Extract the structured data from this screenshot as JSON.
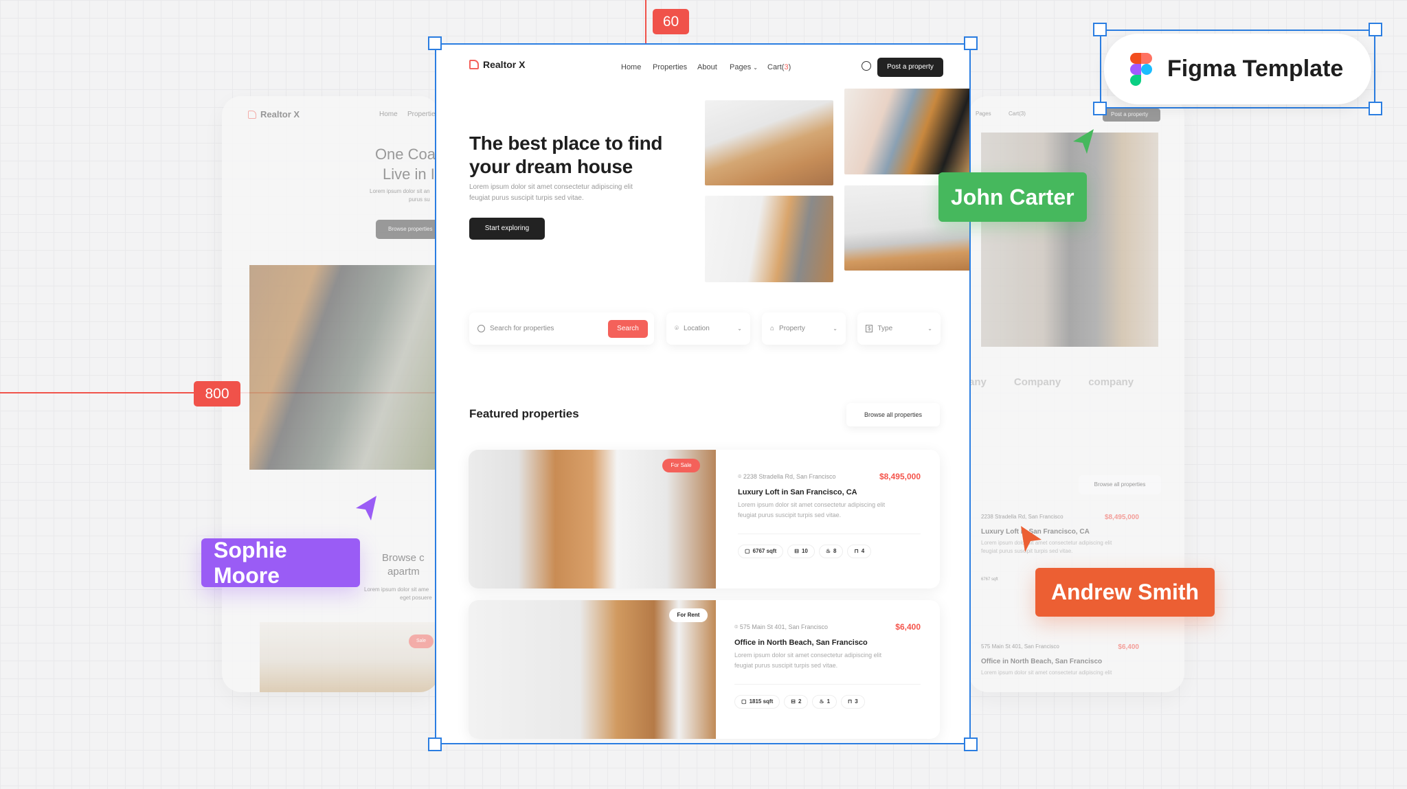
{
  "annotations": {
    "top_measure": "60",
    "left_measure": "800",
    "figma_badge": "Figma Template"
  },
  "collaborators": [
    {
      "name": "John Carter",
      "color": "#46b85d"
    },
    {
      "name": "Sophie Moore",
      "color": "#9a5cf5"
    },
    {
      "name": "Andrew Smith",
      "color": "#ec5f33"
    }
  ],
  "colors": {
    "accent": "#f4615a",
    "selection": "#2a7de1",
    "measure": "#f0524a",
    "dark": "#222222"
  },
  "left_bg": {
    "logo": "Realtor X",
    "nav": [
      "Home",
      "Properties"
    ],
    "hero_title_1": "One Coas",
    "hero_title_2": "Live in I",
    "text_1": "Lorem ipsum dolor sit an",
    "text_2": "purus su",
    "button": "Browse properties",
    "section_title_1": "Browse c",
    "section_title_2": "apartm",
    "section_text_1": "Lorem ipsum dolor sit ame",
    "section_text_2": "eget posuere",
    "badge": "Sale"
  },
  "right_bg": {
    "nav": [
      "Pages",
      "Cart(3)"
    ],
    "post_button": "Post a property",
    "companies": [
      "any",
      "Company",
      "company"
    ],
    "browse_button": "Browse all properties",
    "listings": [
      {
        "address": "2238 Stradella Rd, San Francisco",
        "price": "$8,495,000",
        "title": "Luxury Loft in San Francisco, CA",
        "desc": "Lorem ipsum dolor sit amet consectetur adipiscing elit",
        "desc2": "feugiat purus suscipit turpis sed vitae.",
        "sqft": "6767 sqft"
      },
      {
        "address": "575 Main St 401, San Francisco",
        "price": "$6,400",
        "title": "Office in North Beach, San Francisco",
        "desc": "Lorem ipsum dolor sit amet consectetur adipiscing elit"
      }
    ]
  },
  "header": {
    "logo": "Realtor X",
    "nav": [
      "Home",
      "Properties",
      "About",
      "Pages"
    ],
    "cart_label": "Cart(",
    "cart_count": "3",
    "cart_close": ")",
    "post_button": "Post a property"
  },
  "hero": {
    "title_1": "The best place to find",
    "title_2": "your dream house",
    "text_1": "Lorem ipsum dolor sit amet consectetur adipiscing elit",
    "text_2": "feugiat purus suscipit turpis sed vitae.",
    "cta": "Start exploring"
  },
  "search": {
    "placeholder": "Search for properties",
    "button": "Search",
    "filters": [
      {
        "label": "Location",
        "icon": "map-pin-icon"
      },
      {
        "label": "Property",
        "icon": "house-icon"
      },
      {
        "label": "Type",
        "icon": "dollar-icon"
      }
    ]
  },
  "featured": {
    "title": "Featured properties",
    "browse_button": "Browse all properties",
    "listings": [
      {
        "badge": "For Sale",
        "address": "2238 Stradella Rd, San Francisco",
        "price": "$8,495,000",
        "title": "Luxury Loft in San Francisco, CA",
        "desc_1": "Lorem ipsum dolor sit amet consectetur adipiscing elit",
        "desc_2": "feugiat purus suscipit turpis sed vitae.",
        "sqft": "6767 sqft",
        "beds": "10",
        "baths": "8",
        "garage": "4"
      },
      {
        "badge": "For Rent",
        "address": "575 Main St 401, San Francisco",
        "price": "$6,400",
        "title": "Office in North Beach, San Francisco",
        "desc_1": "Lorem ipsum dolor sit amet consectetur adipiscing elit",
        "desc_2": "feugiat purus suscipit turpis sed vitae.",
        "sqft": "1815 sqft",
        "beds": "2",
        "baths": "1",
        "garage": "3"
      }
    ]
  }
}
